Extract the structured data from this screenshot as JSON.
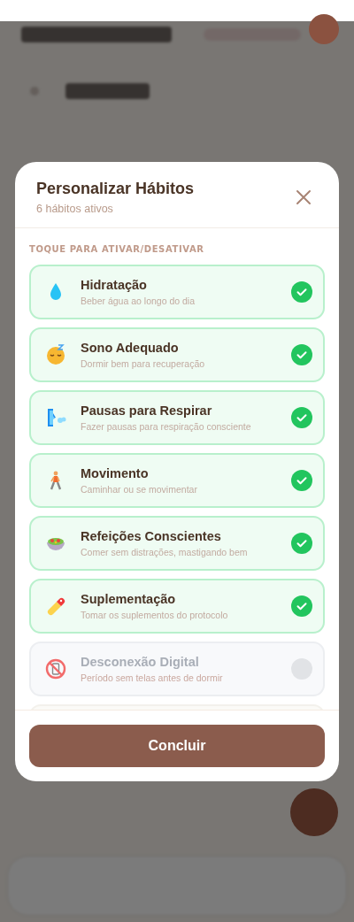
{
  "modal": {
    "title": "Personalizar Hábitos",
    "subtitle": "6 hábitos ativos",
    "section_label": "TOQUE PARA ATIVAR/DESATIVAR",
    "habits": [
      {
        "name": "Hidratação",
        "description": "Beber água ao longo do dia",
        "on": true
      },
      {
        "name": "Sono Adequado",
        "description": "Dormir bem para recuperação",
        "on": true
      },
      {
        "name": "Pausas para Respirar",
        "description": "Fazer pausas para respiração consciente",
        "on": true
      },
      {
        "name": "Movimento",
        "description": "Caminhar ou se movimentar",
        "on": true
      },
      {
        "name": "Refeições Conscientes",
        "description": "Comer sem distrações, mastigando bem",
        "on": true
      },
      {
        "name": "Suplementação",
        "description": "Tomar os suplementos do protocolo",
        "on": true
      },
      {
        "name": "Desconexão Digital",
        "description": "Período sem telas antes de dormir",
        "on": false
      }
    ],
    "done_button": "Concluir"
  }
}
